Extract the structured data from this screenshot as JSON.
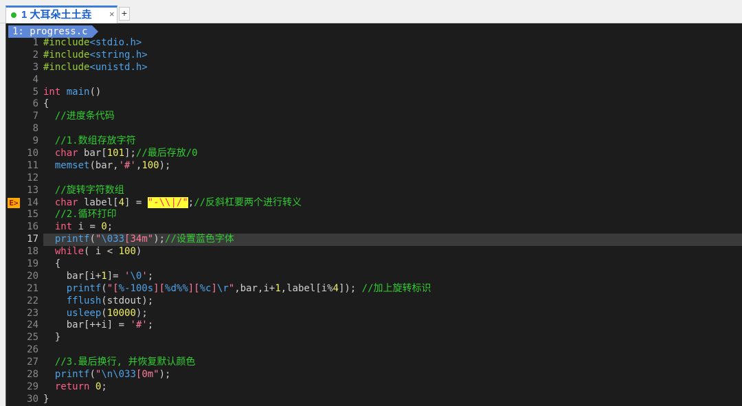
{
  "tab": {
    "title": "1 大耳朵土土垚",
    "close": "×",
    "new_tab": "+"
  },
  "buffer_tab": {
    "label": "1: progress.c"
  },
  "sign": {
    "label": "E>",
    "line": 14
  },
  "current_line": 17,
  "code_lines": [
    {
      "n": "1",
      "tokens": [
        [
          "p",
          "#include"
        ],
        [
          "f",
          "<stdio.h>"
        ]
      ]
    },
    {
      "n": "2",
      "tokens": [
        [
          "p",
          "#include"
        ],
        [
          "f",
          "<string.h>"
        ]
      ]
    },
    {
      "n": "3",
      "tokens": [
        [
          "p",
          "#include"
        ],
        [
          "f",
          "<unistd.h>"
        ]
      ]
    },
    {
      "n": "4",
      "tokens": []
    },
    {
      "n": "5",
      "tokens": [
        [
          "k",
          "int"
        ],
        [
          "t",
          " "
        ],
        [
          "f",
          "main"
        ],
        [
          "t",
          "()"
        ]
      ]
    },
    {
      "n": "6",
      "tokens": [
        [
          "t",
          "{"
        ]
      ]
    },
    {
      "n": "7",
      "tokens": [
        [
          "t",
          "  "
        ],
        [
          "c",
          "//进度条代码"
        ]
      ]
    },
    {
      "n": "8",
      "tokens": []
    },
    {
      "n": "9",
      "tokens": [
        [
          "t",
          "  "
        ],
        [
          "c",
          "//1.数组存放字符"
        ]
      ]
    },
    {
      "n": "10",
      "tokens": [
        [
          "t",
          "  "
        ],
        [
          "k",
          "char"
        ],
        [
          "t",
          " bar["
        ],
        [
          "n",
          "101"
        ],
        [
          "t",
          "];"
        ],
        [
          "c",
          "//最后存放/0"
        ]
      ]
    },
    {
      "n": "11",
      "tokens": [
        [
          "t",
          "  "
        ],
        [
          "f",
          "memset"
        ],
        [
          "t",
          "(bar,"
        ],
        [
          "s",
          "'#'"
        ],
        [
          "t",
          ","
        ],
        [
          "n",
          "100"
        ],
        [
          "t",
          ");"
        ]
      ]
    },
    {
      "n": "12",
      "tokens": []
    },
    {
      "n": "13",
      "tokens": [
        [
          "t",
          "  "
        ],
        [
          "c",
          "//旋转字符数组"
        ]
      ]
    },
    {
      "n": "14",
      "tokens": [
        [
          "t",
          "  "
        ],
        [
          "k",
          "char"
        ],
        [
          "t",
          " label["
        ],
        [
          "n",
          "4"
        ],
        [
          "t",
          "] = "
        ],
        [
          "hl",
          "\"-\\\\|/\""
        ],
        [
          "t",
          ";"
        ],
        [
          "c",
          "//反斜杠要两个进行转义"
        ]
      ]
    },
    {
      "n": "15",
      "tokens": [
        [
          "t",
          "  "
        ],
        [
          "c",
          "//2.循环打印"
        ]
      ]
    },
    {
      "n": "16",
      "tokens": [
        [
          "t",
          "  "
        ],
        [
          "k",
          "int"
        ],
        [
          "t",
          " i = "
        ],
        [
          "n",
          "0"
        ],
        [
          "t",
          ";"
        ]
      ]
    },
    {
      "n": "17",
      "tokens": [
        [
          "t",
          "  "
        ],
        [
          "f",
          "printf"
        ],
        [
          "t",
          "("
        ],
        [
          "s",
          "\""
        ],
        [
          "e",
          "\\033"
        ],
        [
          "s",
          "[34m\""
        ],
        [
          "t",
          ");"
        ],
        [
          "c",
          "//设置蓝色字体"
        ]
      ]
    },
    {
      "n": "18",
      "tokens": [
        [
          "t",
          "  "
        ],
        [
          "k",
          "while"
        ],
        [
          "t",
          "( i < "
        ],
        [
          "n",
          "100"
        ],
        [
          "t",
          ")"
        ]
      ]
    },
    {
      "n": "19",
      "tokens": [
        [
          "t",
          "  {"
        ]
      ]
    },
    {
      "n": "20",
      "tokens": [
        [
          "t",
          "    bar[i+"
        ],
        [
          "n",
          "1"
        ],
        [
          "t",
          "]= "
        ],
        [
          "s",
          "'"
        ],
        [
          "e",
          "\\0"
        ],
        [
          "s",
          "'"
        ],
        [
          "t",
          ";"
        ]
      ]
    },
    {
      "n": "21",
      "tokens": [
        [
          "t",
          "    "
        ],
        [
          "f",
          "printf"
        ],
        [
          "t",
          "("
        ],
        [
          "s",
          "\"["
        ],
        [
          "e",
          "%-100s"
        ],
        [
          "s",
          "]["
        ],
        [
          "e",
          "%d%%"
        ],
        [
          "s",
          "]["
        ],
        [
          "e",
          "%c"
        ],
        [
          "s",
          "]"
        ],
        [
          "e",
          "\\r"
        ],
        [
          "s",
          "\""
        ],
        [
          "t",
          ",bar,i+"
        ],
        [
          "n",
          "1"
        ],
        [
          "t",
          ",label[i%"
        ],
        [
          "n",
          "4"
        ],
        [
          "t",
          "]); "
        ],
        [
          "c",
          "//加上旋转标识"
        ]
      ]
    },
    {
      "n": "22",
      "tokens": [
        [
          "t",
          "    "
        ],
        [
          "f",
          "fflush"
        ],
        [
          "t",
          "(stdout);"
        ]
      ]
    },
    {
      "n": "23",
      "tokens": [
        [
          "t",
          "    "
        ],
        [
          "f",
          "usleep"
        ],
        [
          "t",
          "("
        ],
        [
          "n",
          "10000"
        ],
        [
          "t",
          ");"
        ]
      ]
    },
    {
      "n": "24",
      "tokens": [
        [
          "t",
          "    bar[++i] = "
        ],
        [
          "s",
          "'#'"
        ],
        [
          "t",
          ";"
        ]
      ]
    },
    {
      "n": "25",
      "tokens": [
        [
          "t",
          "  }"
        ]
      ]
    },
    {
      "n": "26",
      "tokens": []
    },
    {
      "n": "27",
      "tokens": [
        [
          "t",
          "  "
        ],
        [
          "c",
          "//3.最后换行, 并恢复默认颜色"
        ]
      ]
    },
    {
      "n": "28",
      "tokens": [
        [
          "t",
          "  "
        ],
        [
          "f",
          "printf"
        ],
        [
          "t",
          "("
        ],
        [
          "s",
          "\""
        ],
        [
          "e",
          "\\n\\033"
        ],
        [
          "s",
          "[0m\""
        ],
        [
          "t",
          ");"
        ]
      ]
    },
    {
      "n": "29",
      "tokens": [
        [
          "t",
          "  "
        ],
        [
          "k",
          "return"
        ],
        [
          "t",
          " "
        ],
        [
          "n",
          "0"
        ],
        [
          "t",
          ";"
        ]
      ]
    },
    {
      "n": "30",
      "tokens": [
        [
          "t",
          "}"
        ]
      ]
    }
  ],
  "colors": {
    "keyword": "#ff5f87",
    "preprocessor": "#9acd32",
    "function": "#4fa3e8",
    "comment": "#32cd32",
    "string": "#ff7a9c",
    "number": "#f0f066",
    "buffer_tab_bg": "#5f87d7"
  }
}
